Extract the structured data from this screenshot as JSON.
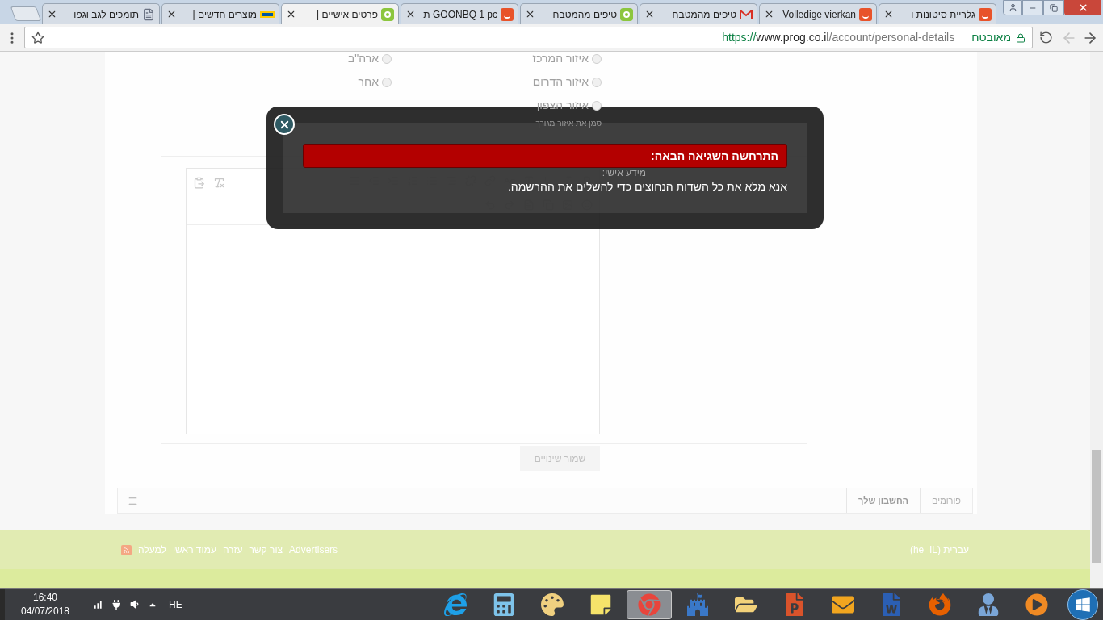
{
  "browser": {
    "tabs": [
      {
        "title": "גלריית סיטונות ו",
        "kind": "shop",
        "selected": false
      },
      {
        "title": "Volledige vierkan",
        "kind": "shop",
        "selected": false
      },
      {
        "title": "טיפים מהמטבח",
        "kind": "mail",
        "selected": false
      },
      {
        "title": "טיפים מהמטבח",
        "kind": "site",
        "selected": false
      },
      {
        "title": "GOONBQ 1 pc ת",
        "kind": "shop",
        "selected": false
      },
      {
        "title": "פרטים אישיים |",
        "kind": "site",
        "selected": true
      },
      {
        "title": "מוצרים חדשים |",
        "kind": "store",
        "selected": false
      },
      {
        "title": "תומכים לגב וגפו",
        "kind": "page",
        "selected": false
      }
    ],
    "address_bar": {
      "security": "מאובטח",
      "url_scheme": "https://",
      "url_host": "www.prog.co.il",
      "url_path": "/account/personal-details"
    }
  },
  "page": {
    "region_options": [
      {
        "label": "איזור המרכז",
        "selected": false
      },
      {
        "label": "ארה\"ב",
        "selected": false
      },
      {
        "label": "איזור הדרום",
        "selected": false
      },
      {
        "label": "אחר",
        "selected": false
      },
      {
        "label": "איזור הצפון",
        "selected": false
      }
    ],
    "region_hint": "סמן את איזור מגורך",
    "personal_info_label": "מידע אישי:",
    "save_button": {
      "label": "שמור שינויים",
      "disabled": true
    },
    "breadcrumbs": [
      {
        "label": "פורומים",
        "selected": false
      },
      {
        "label": "החשבון שלך",
        "selected": true
      }
    ],
    "footer": {
      "language": "עברית (he_IL)",
      "links": [
        "Advertisers",
        "צור קשר",
        "עזרה",
        "עמוד ראשי",
        "למעלה"
      ]
    }
  },
  "error_dialog": {
    "title": "התרחשה השגיאה הבאה:",
    "message": "אנא מלא את כל השדות הנחוצים כדי להשלים את ההרשמה."
  },
  "taskbar": {
    "time": "16:40",
    "date": "04/07/2018",
    "language": "HE",
    "apps": [
      {
        "kind": "ie",
        "active": false
      },
      {
        "kind": "calculator",
        "active": false
      },
      {
        "kind": "paint",
        "active": false
      },
      {
        "kind": "notes",
        "active": false
      },
      {
        "kind": "chrome",
        "active": true
      },
      {
        "kind": "castle",
        "active": false
      },
      {
        "kind": "folder",
        "active": false
      },
      {
        "kind": "slides",
        "active": false
      },
      {
        "kind": "mail",
        "active": false
      },
      {
        "kind": "word",
        "active": false
      },
      {
        "kind": "firefox",
        "active": false
      },
      {
        "kind": "person",
        "active": false
      },
      {
        "kind": "player",
        "active": false
      }
    ]
  }
}
